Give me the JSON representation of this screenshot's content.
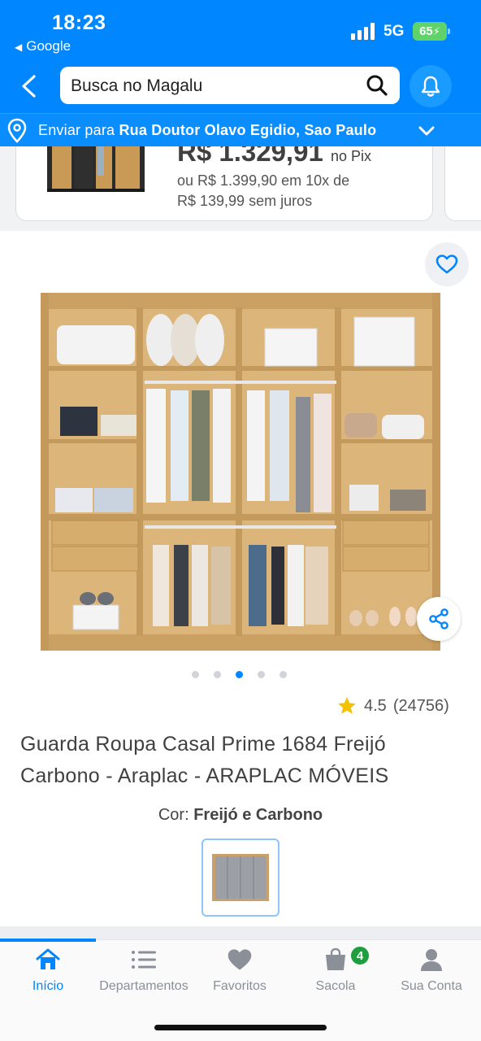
{
  "status_bar": {
    "time": "18:23",
    "back_app": "Google",
    "network": "5G",
    "battery": "65"
  },
  "header": {
    "search_placeholder": "Busca no Magalu",
    "location_prefix": "Enviar para",
    "location_address": "Rua Doutor Olavo Egidio, Sao Paulo"
  },
  "previous_card": {
    "price": "R$ 1.329,91",
    "price_suffix": "no Pix",
    "installment_line1": "ou R$ 1.399,90 em 10x de",
    "installment_line2": "R$ 139,99 sem juros"
  },
  "product": {
    "rating": "4.5",
    "review_count": "(24756)",
    "title": "Guarda Roupa Casal Prime 1684 Freijó Carbono - Araplac - ARAPLAC MÓVEIS",
    "color_label": "Cor:",
    "color_value": "Freijó e Carbono",
    "image_count": 5,
    "active_image": 3
  },
  "tabs": [
    {
      "label": "Início",
      "icon": "home-icon",
      "active": true
    },
    {
      "label": "Departamentos",
      "icon": "list-icon",
      "active": false
    },
    {
      "label": "Favoritos",
      "icon": "heart-icon",
      "active": false
    },
    {
      "label": "Sacola",
      "icon": "bag-icon",
      "active": false,
      "badge": "4"
    },
    {
      "label": "Sua Conta",
      "icon": "user-icon",
      "active": false
    }
  ],
  "colors": {
    "brand_blue": "#0086ff",
    "text_dark": "#404040",
    "badge_green": "#1f9e3f",
    "star_yellow": "#f2c200",
    "wood": "#d9b176"
  }
}
